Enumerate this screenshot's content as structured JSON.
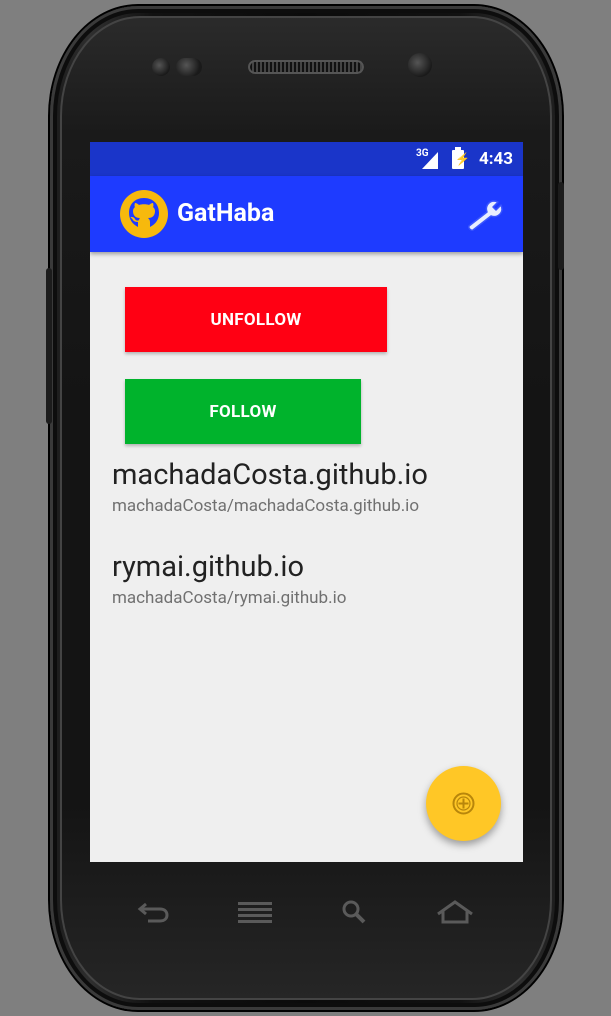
{
  "status_bar": {
    "network": "3G",
    "time": "4:43"
  },
  "app_bar": {
    "title": "GatHaba",
    "logo_icon": "github-octocat-icon",
    "action_icon": "wrench-icon"
  },
  "buttons": {
    "unfollow_label": "UNFOLLOW",
    "follow_label": "FOLLOW"
  },
  "repos": [
    {
      "name": "machadaCosta.github.io",
      "path": "machadaCosta/machadaCosta.github.io"
    },
    {
      "name": "rymai.github.io",
      "path": "machadaCosta/rymai.github.io"
    }
  ],
  "fab": {
    "icon": "add-circle-icon"
  },
  "nav_keys": [
    "back-icon",
    "menu-icon",
    "search-icon",
    "home-icon"
  ],
  "colors": {
    "status_bar": "#1a35c9",
    "app_bar": "#1e3bff",
    "unfollow": "#ff0013",
    "follow": "#00b32c",
    "fab": "#ffc726",
    "screen_bg": "#efefef"
  }
}
